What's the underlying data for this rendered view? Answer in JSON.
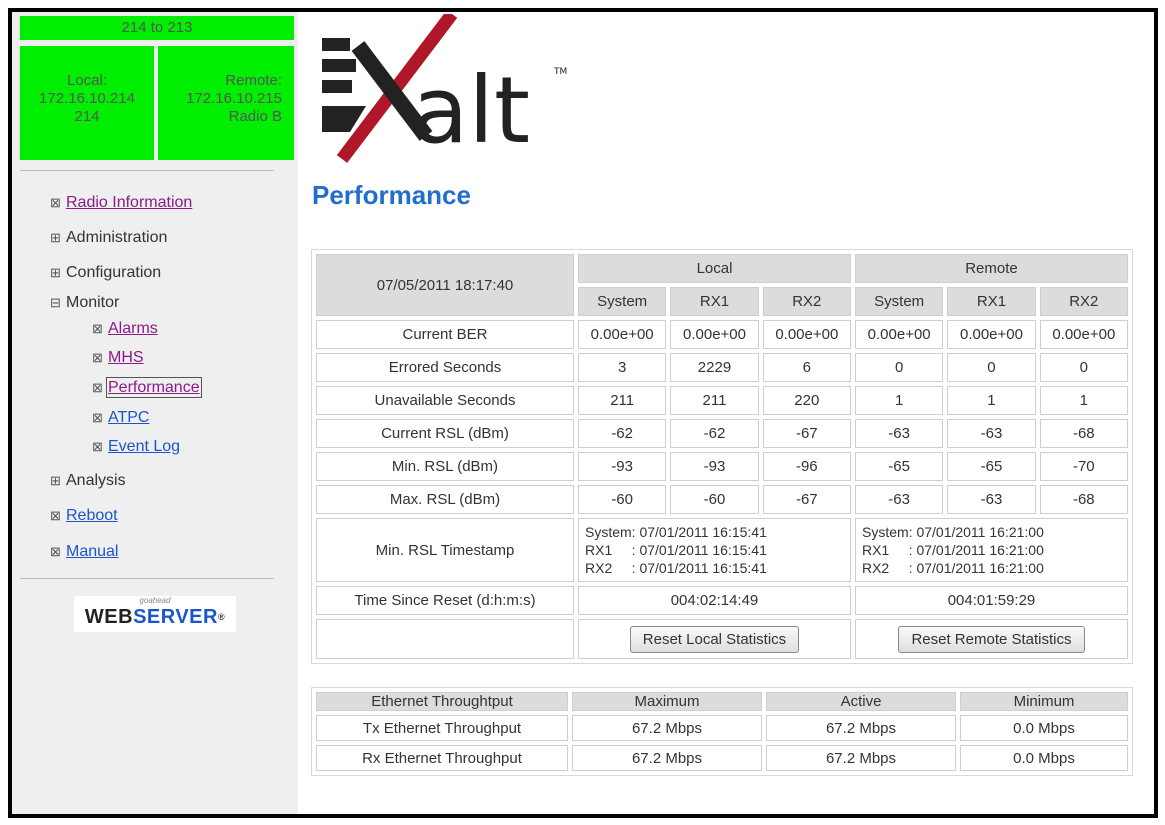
{
  "sidebar": {
    "link_label": "214 to 213",
    "local": {
      "label": "Local:",
      "ip": "172.16.10.214",
      "name": "214"
    },
    "remote": {
      "label": "Remote:",
      "ip": "172.16.10.215",
      "name": "Radio B"
    },
    "nav": {
      "radio_information": "Radio Information",
      "administration": "Administration",
      "configuration": "Configuration",
      "monitor": "Monitor",
      "alarms": "Alarms",
      "mhs": "MHS",
      "performance": "Performance",
      "atpc": "ATPC",
      "event_log": "Event Log",
      "analysis": "Analysis",
      "reboot": "Reboot",
      "manual": "Manual"
    },
    "webserver": {
      "small": "goahead",
      "web": "WEB",
      "server": "SERVER"
    }
  },
  "logo": {
    "text": "alt",
    "tm": "TM"
  },
  "page_title": "Performance",
  "performance": {
    "timestamp": "07/05/2011 18:17:40",
    "local_label": "Local",
    "remote_label": "Remote",
    "subheaders": [
      "System",
      "RX1",
      "RX2",
      "System",
      "RX1",
      "RX2"
    ],
    "rows": [
      {
        "label": "Current BER",
        "values": [
          "0.00e+00",
          "0.00e+00",
          "0.00e+00",
          "0.00e+00",
          "0.00e+00",
          "0.00e+00"
        ]
      },
      {
        "label": "Errored Seconds",
        "values": [
          "3",
          "2229",
          "6",
          "0",
          "0",
          "0"
        ]
      },
      {
        "label": "Unavailable Seconds",
        "values": [
          "211",
          "211",
          "220",
          "1",
          "1",
          "1"
        ]
      },
      {
        "label": "Current RSL (dBm)",
        "values": [
          "-62",
          "-62",
          "-67",
          "-63",
          "-63",
          "-68"
        ]
      },
      {
        "label": "Min. RSL (dBm)",
        "values": [
          "-93",
          "-93",
          "-96",
          "-65",
          "-65",
          "-70"
        ]
      },
      {
        "label": "Max. RSL (dBm)",
        "values": [
          "-60",
          "-60",
          "-67",
          "-63",
          "-63",
          "-68"
        ]
      }
    ],
    "min_rsl_timestamp": {
      "label": "Min. RSL Timestamp",
      "local": [
        "System: 07/01/2011 16:15:41",
        "RX1     : 07/01/2011 16:15:41",
        "RX2     : 07/01/2011 16:15:41"
      ],
      "remote": [
        "System: 07/01/2011 16:21:00",
        "RX1     : 07/01/2011 16:21:00",
        "RX2     : 07/01/2011 16:21:00"
      ]
    },
    "time_since_reset": {
      "label": "Time Since Reset (d:h:m:s)",
      "local": "004:02:14:49",
      "remote": "004:01:59:29"
    },
    "reset_local_label": "Reset Local Statistics",
    "reset_remote_label": "Reset Remote Statistics"
  },
  "ethernet": {
    "headers": [
      "Ethernet Throughtput",
      "Maximum",
      "Active",
      "Minimum"
    ],
    "rows": [
      {
        "label": "Tx Ethernet Throughput",
        "values": [
          "67.2 Mbps",
          "67.2 Mbps",
          "0.0 Mbps"
        ]
      },
      {
        "label": "Rx Ethernet Throughput",
        "values": [
          "67.2 Mbps",
          "67.2 Mbps",
          "0.0 Mbps"
        ]
      }
    ]
  },
  "colors": {
    "accent_green": "#00ee00",
    "title_blue": "#1f6fcf",
    "logo_red": "#b0182a"
  }
}
